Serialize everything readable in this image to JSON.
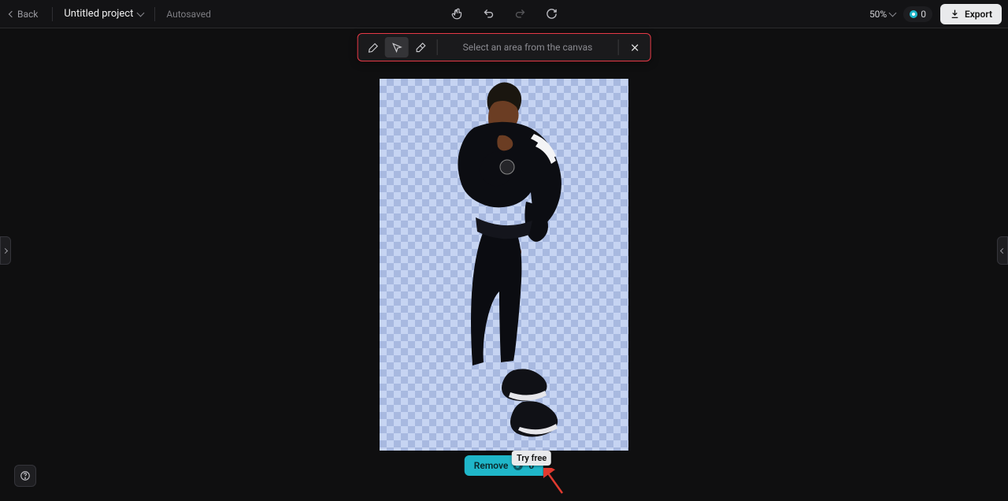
{
  "header": {
    "back_label": "Back",
    "project_name": "Untitled project",
    "autosave_status": "Autosaved",
    "zoom_label": "50%",
    "credits_count": "0",
    "export_label": "Export"
  },
  "toolbar": {
    "hint_text": "Select an area from the canvas",
    "tools": {
      "brush": "brush",
      "select": "select",
      "erase": "erase",
      "close": "close"
    }
  },
  "action": {
    "remove_label": "Remove",
    "remove_credits": "0",
    "tryfree_label": "Try free"
  },
  "help": {
    "label": "?"
  },
  "canvas": {
    "subject_description": "person posing on transparent background"
  }
}
